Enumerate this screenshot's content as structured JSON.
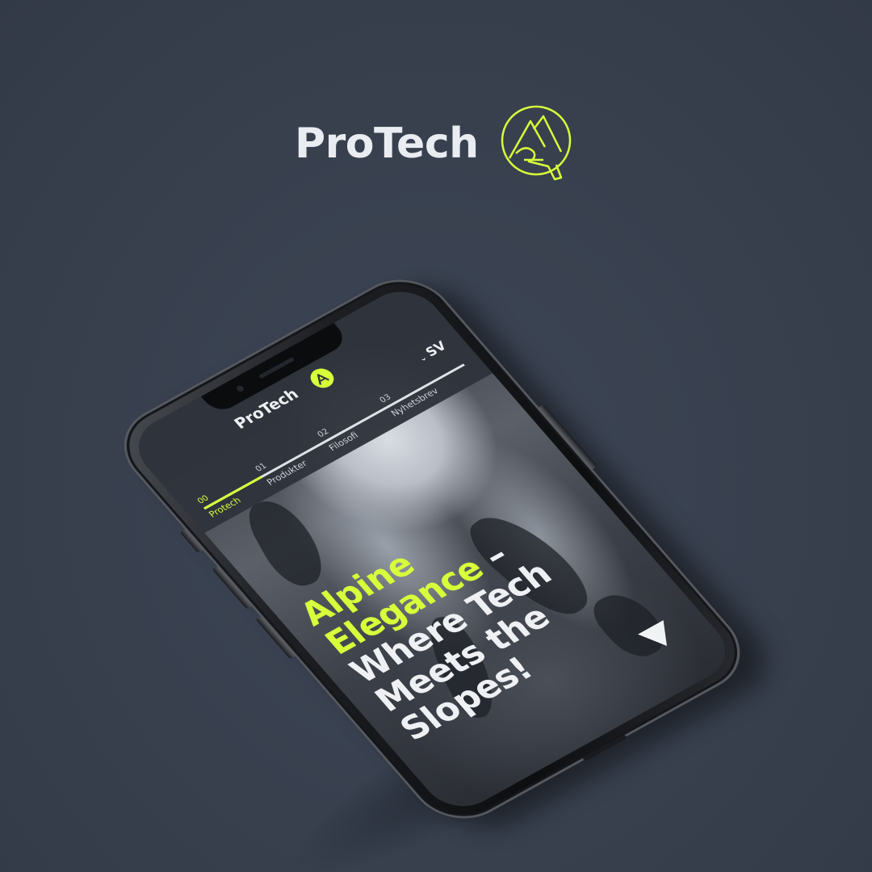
{
  "brand": {
    "title": "ProTech",
    "logo_icon": "mountain-a-logo-icon"
  },
  "app": {
    "brand_name": "ProTech",
    "brand_icon": "mountain-a-badge-icon",
    "language": "SV",
    "language_icon": "chevron-down-icon",
    "nav": [
      {
        "num": "00",
        "label": "Protech",
        "active": true
      },
      {
        "num": "01",
        "label": "Produkter",
        "active": false
      },
      {
        "num": "02",
        "label": "Filosofi",
        "active": false
      },
      {
        "num": "03",
        "label": "Nyhetsbrev",
        "active": false
      }
    ],
    "hero": {
      "highlight": "Alpine Elegance",
      "rest": " – Where Tech Meets the Slopes!"
    },
    "play_icon": "play-down-arrow-icon"
  },
  "colors": {
    "background": "#39414f",
    "accent": "#d8ff3a",
    "text_light": "#e9ecf1"
  }
}
